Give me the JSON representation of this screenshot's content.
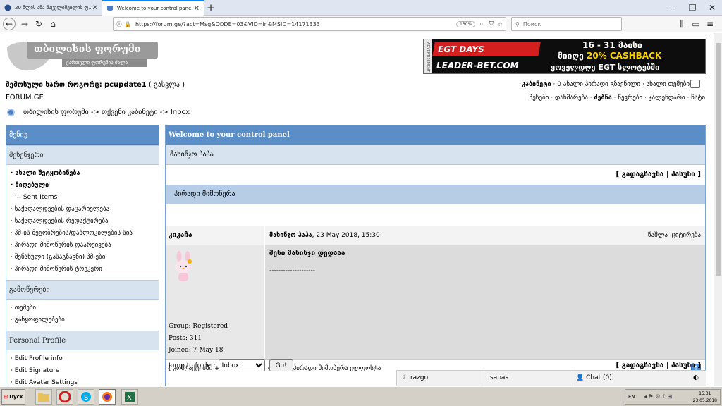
{
  "browser": {
    "tabs": [
      {
        "title": "20 წლის ანა ნაცვლიშვილის ფ..."
      },
      {
        "title": "Welcome to your control panel"
      }
    ],
    "url": "https://forum.ge/?act=Msg&CODE=03&VID=in&MSID=14171333",
    "zoom": "130%",
    "search_placeholder": "Поиск"
  },
  "header": {
    "logo_title": "თბილისის ფორუმი",
    "logo_subtitle": "ქართული ფორუმის ძალა",
    "banner": {
      "side_text": "ADVERTISEMENT",
      "brand": "EGT DAYS",
      "site": "LEADER-BET.COM",
      "dates": "16 - 31 მაისი",
      "cashback_prefix": "მიიღე",
      "cashback_value": "20% CASHBACK",
      "slots": "ყოველდღე EGT სლოტებში"
    },
    "logged_in_prefix": "შემოსული ხართ როგორც:",
    "username": "pcupdate1",
    "logout": "( გასვლა )",
    "site_name": "FORUM.GE",
    "top_links": {
      "cabinet": "კაბინეტი",
      "new_messages": "0 ახალი პირადი გზავნილი",
      "new_topics": "ახალი თემები"
    },
    "menu_links": [
      "წესები",
      "დახმარება",
      "ძებნა",
      "წევრები",
      "კალენდარი",
      "ჩატი"
    ]
  },
  "breadcrumb": "თბილისის ფორუმი -> თქვენი კაბინეტი -> Inbox",
  "sidebar": {
    "title": "მენიუ",
    "sections": [
      {
        "title": "მესენჯერი",
        "items": [
          "· ახალი შეტყობინება",
          "· მიღებული",
          "'-- Sent Items",
          "· საქაღალდეების დაცარიელება",
          "· საქაღალდეების რედაქტირება",
          "· პმ-ის მეგობრების/დაბლოკილების სია",
          "· პირადი მიმოწერის დაარქივება",
          "· შენახული (გასაგზავნი) პმ-ები",
          "· პირადი მიმოწერის ტრეკერი"
        ]
      },
      {
        "title": "გამოწერები",
        "items": [
          "· თემები",
          "· განყოფილებები"
        ]
      },
      {
        "title": "Personal Profile",
        "items": [
          "· Edit Profile info",
          "· Edit Signature",
          "· Edit Avatar Settings"
        ]
      }
    ]
  },
  "main": {
    "title": "Welcome to your control panel",
    "subject": "მახინჯო ჰაჰა",
    "actions": "[ გადაგზავნა | პასუხი ]",
    "section_label": "პირადი მიმოწერა",
    "author": "კიკაჩა",
    "author_stats": {
      "group": "Group: Registered",
      "posts": "Posts: 311",
      "joined": "Joined: 7-May 18"
    },
    "message_title": "მახინჯო ჰაჰა",
    "message_date": ", 23 May 2018, 15:30",
    "delete_label": "წაშლა",
    "quote_label": "ციტირება",
    "body": "შენი მახინჯი დედააა",
    "signature": "--------------------",
    "contact_links": "[ კონტაქტებში + ] [ჩატი]",
    "report_link": "ბარათი პირადი მიმოწერა ელფოსტა",
    "jump_label": "Jump to folder:",
    "jump_value": "Inbox",
    "go_button": "Go!",
    "bottom_actions": "[ გადაგზავნა | პასუხი ]"
  },
  "chat_bar": {
    "user1": "razgo",
    "user2": "sabas",
    "chat_label": "Chat (0)"
  },
  "taskbar": {
    "start_label": "Пуск",
    "lang": "EN",
    "time": "15:31",
    "date": "23.05.2018"
  },
  "colors": {
    "header_blue": "#5b8ec6",
    "light_blue": "#d8e3f0",
    "pm_blue": "#b7cde6",
    "message_gray": "#dcdcdc"
  }
}
